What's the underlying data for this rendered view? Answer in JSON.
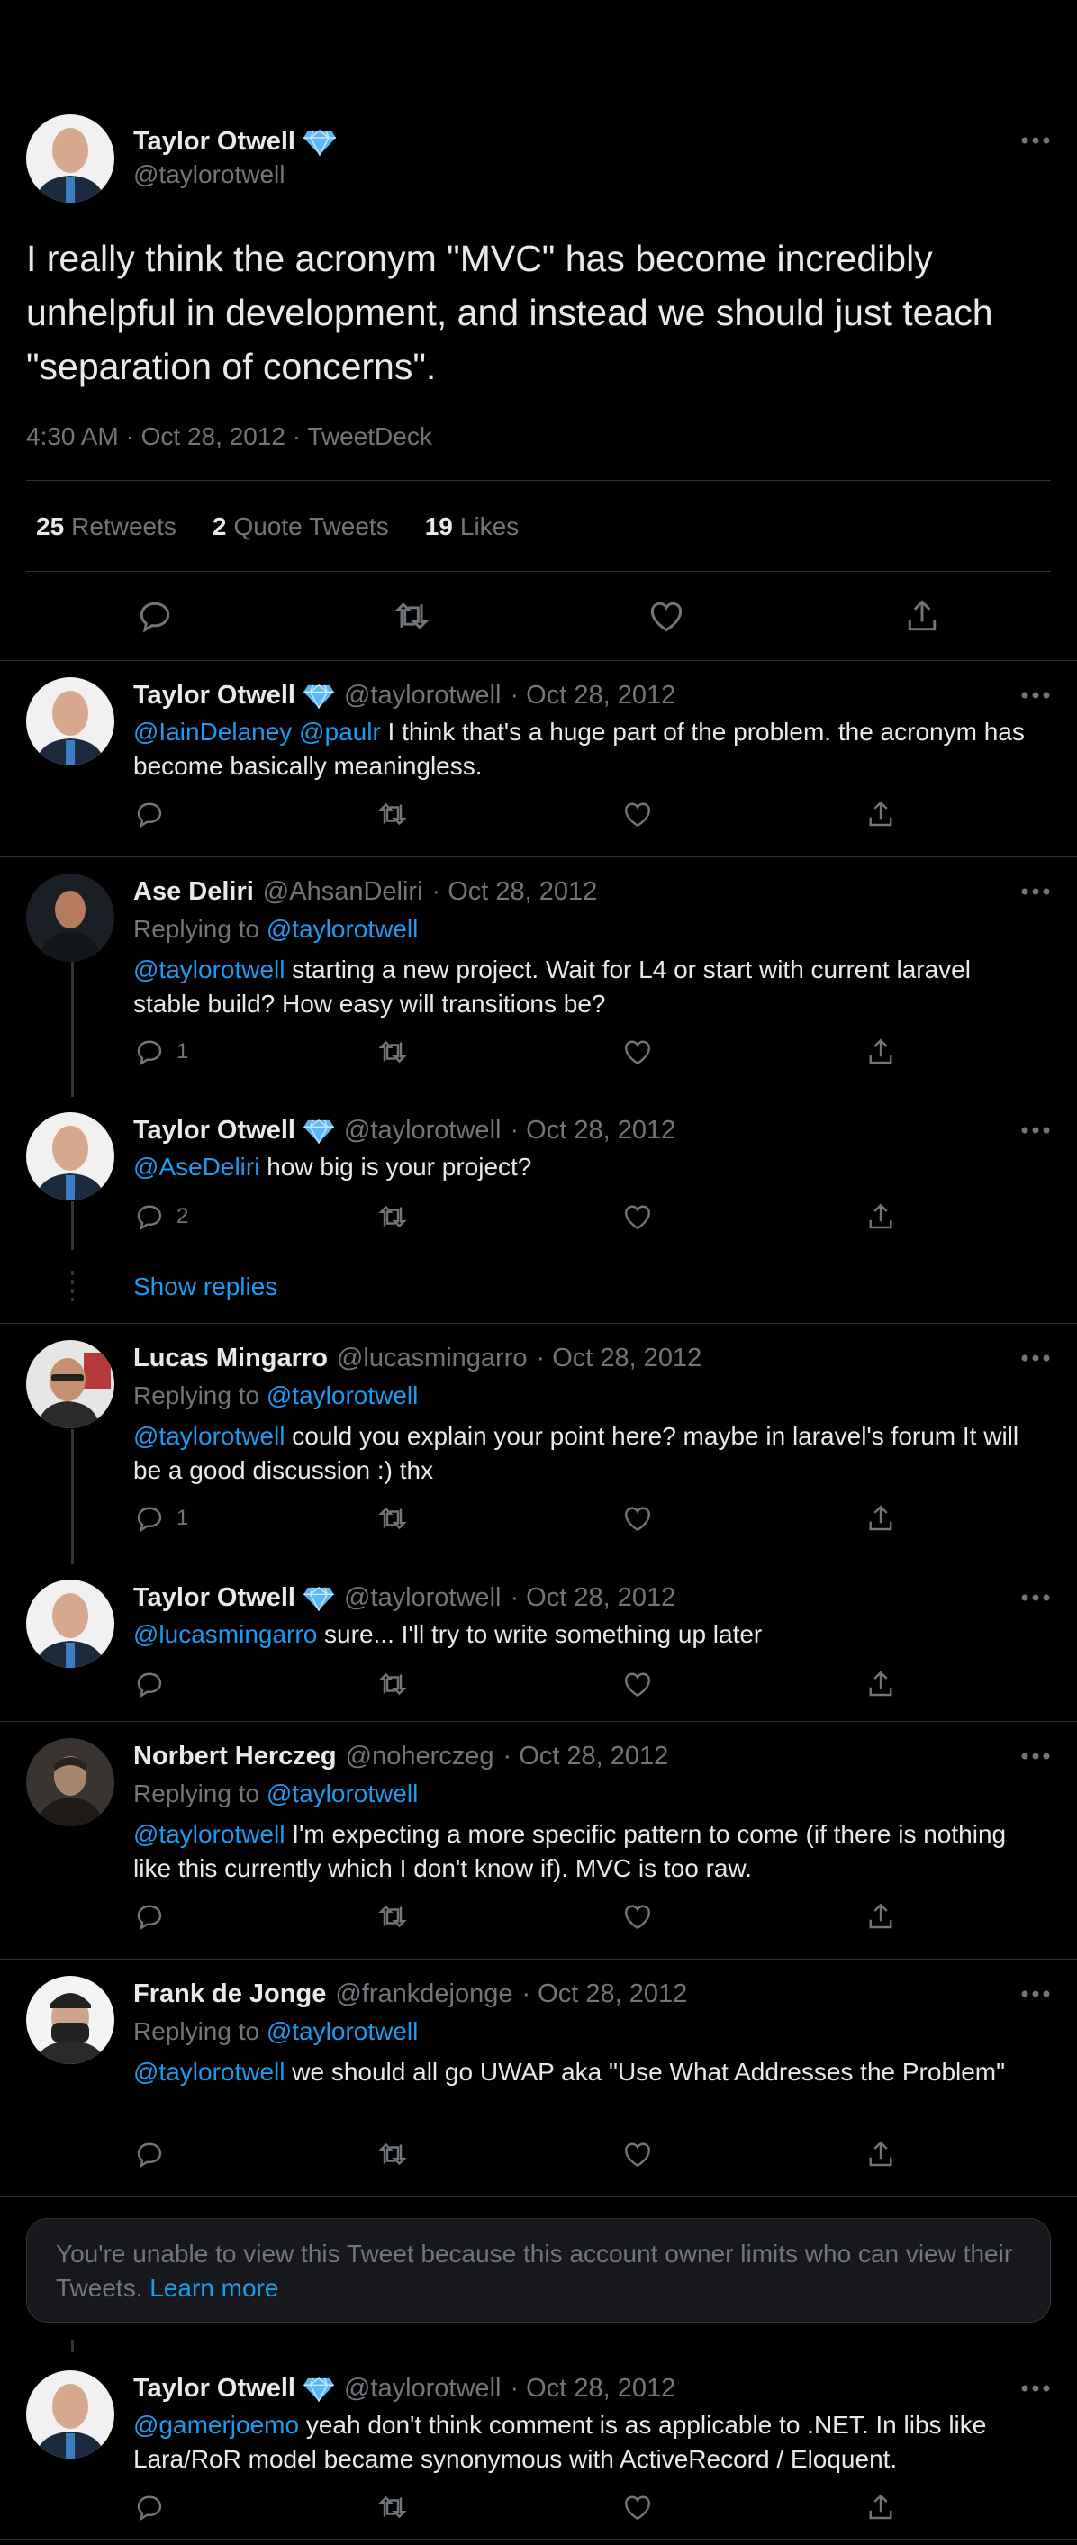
{
  "colors": {
    "background": "#000000",
    "text": "#e7e9ea",
    "secondary": "#71767b",
    "accent": "#1d9bf0",
    "verified_badge": "#5bb7f5",
    "divider": "#2f3336"
  },
  "main_tweet": {
    "author_name": "Taylor Otwell",
    "verified_icon": "diamond-badge-icon",
    "handle": "@taylorotwell",
    "text": "I really think the acronym \"MVC\" has become incredibly unhelpful in development, and instead we should just teach \"separation of concerns\".",
    "time": "4:30 AM · Oct 28, 2012 · TweetDeck",
    "stats": {
      "retweets_count": "25",
      "retweets_label": "Retweets",
      "quotes_count": "2",
      "quotes_label": "Quote Tweets",
      "likes_count": "19",
      "likes_label": "Likes"
    },
    "actions": [
      "reply-icon",
      "retweet-icon",
      "like-icon",
      "share-icon"
    ]
  },
  "replies": [
    {
      "name": "Taylor Otwell",
      "handle": "@taylorotwell",
      "date": "· Oct 28, 2012",
      "mention": "@IainDelaney @paulr",
      "text": " I think that's a huge part of the problem. the acronym has become basically meaningless.",
      "reply_count": ""
    },
    {
      "name": "Ase Deliri",
      "handle": "@AhsanDeliri",
      "date": "· Oct 28, 2012",
      "replying_label": "Replying to",
      "replying_to": "@taylorotwell",
      "mention": "@taylorotwell",
      "text": " starting a new project. Wait for L4 or start with current laravel stable build? How easy will transitions be?",
      "reply_count": "1"
    },
    {
      "name": "Taylor Otwell",
      "handle": "@taylorotwell",
      "date": "· Oct 28, 2012",
      "mention": "@AseDeliri",
      "text": " how big is your project?",
      "reply_count": "2"
    },
    {
      "name": "Lucas Mingarro",
      "handle": "@lucasmingarro",
      "date": "· Oct 28, 2012",
      "replying_label": "Replying to",
      "replying_to": "@taylorotwell",
      "mention": "@taylorotwell",
      "text": " could you explain your point here? maybe in laravel's forum It will be a good discussion :) thx",
      "reply_count": "1"
    },
    {
      "name": "Taylor Otwell",
      "handle": "@taylorotwell",
      "date": "· Oct 28, 2012",
      "mention": "@lucasmingarro",
      "text": " sure... I'll try to write something up later",
      "reply_count": ""
    },
    {
      "name": "Norbert Herczeg",
      "handle": "@noherczeg",
      "date": "· Oct 28, 2012",
      "replying_label": "Replying to",
      "replying_to": "@taylorotwell",
      "mention": "@taylorotwell",
      "text": " I'm expecting a more specific pattern to come (if there is nothing like this currently which I don't know if). MVC is too raw.",
      "reply_count": ""
    },
    {
      "name": "Frank de Jonge",
      "handle": "@frankdejonge",
      "date": "· Oct 28, 2012",
      "replying_label": "Replying to",
      "replying_to": "@taylorotwell",
      "mention": "@taylorotwell",
      "text": " we should all go UWAP aka \"Use What Addresses the Problem\"",
      "reply_count": ""
    },
    {
      "name": "Taylor Otwell",
      "handle": "@taylorotwell",
      "date": "· Oct 28, 2012",
      "mention": "@gamerjoemo",
      "text": " yeah don't think comment is as applicable to .NET. In libs like Lara/RoR model became synonymous with ActiveRecord / Eloquent.",
      "reply_count": ""
    }
  ],
  "show_replies": "Show replies",
  "limited_notice": {
    "text": "You're unable to view this Tweet because this account owner limits who can view their Tweets. ",
    "link": "Learn more"
  }
}
